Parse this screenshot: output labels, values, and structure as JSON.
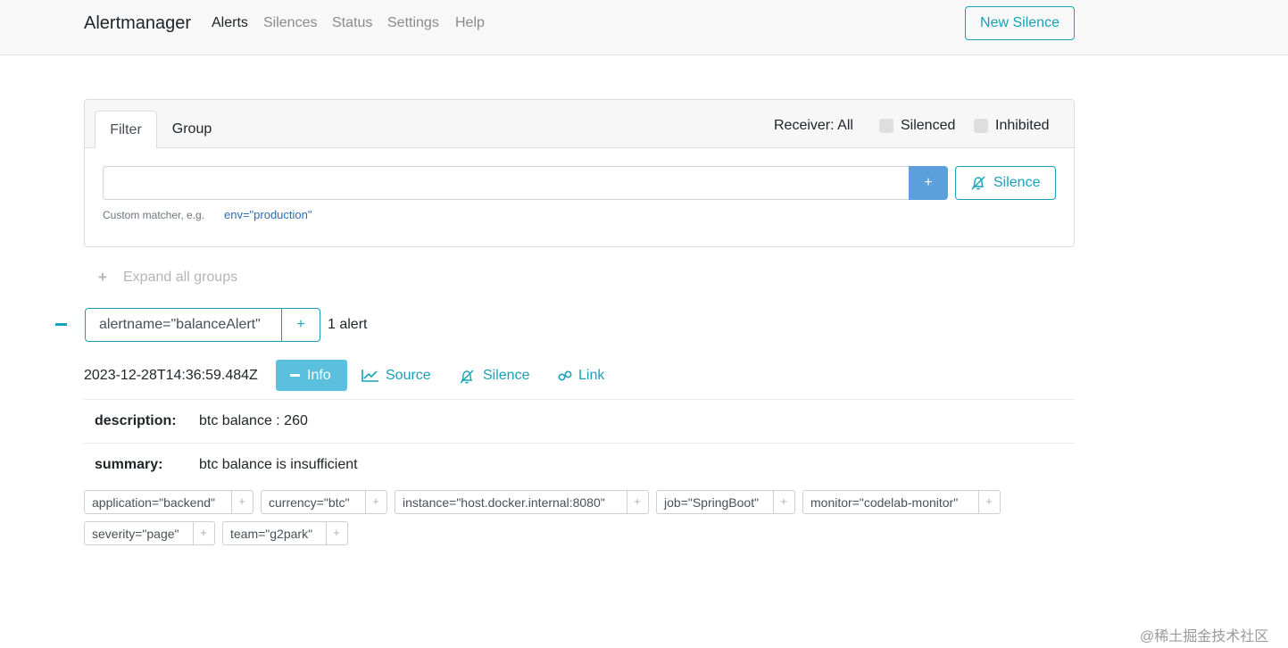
{
  "nav": {
    "brand": "Alertmanager",
    "links": [
      "Alerts",
      "Silences",
      "Status",
      "Settings",
      "Help"
    ],
    "new_silence": "New Silence"
  },
  "filter_card": {
    "tabs": [
      "Filter",
      "Group"
    ],
    "receiver": "Receiver: All",
    "silenced_label": "Silenced",
    "inhibited_label": "Inhibited",
    "input_value": "",
    "add_button": "+",
    "silence_button": "Silence",
    "hint": "Custom matcher, e.g.",
    "hint_example": "env=\"production\""
  },
  "expand_all": {
    "plus": "+",
    "label": "Expand all groups"
  },
  "group": {
    "matcher": "alertname=\"balanceAlert\"",
    "add": "+",
    "count": "1 alert"
  },
  "alert": {
    "time": "2023-12-28T14:36:59.484Z",
    "info": "Info",
    "source": "Source",
    "silence": "Silence",
    "link": "Link",
    "annotations": [
      {
        "key": "description:",
        "value": "btc balance : 260"
      },
      {
        "key": "summary:",
        "value": "btc balance is insufficient"
      }
    ],
    "labels": [
      "application=\"backend\"",
      "currency=\"btc\"",
      "instance=\"host.docker.internal:8080\"",
      "job=\"SpringBoot\"",
      "monitor=\"codelab-monitor\"",
      "severity=\"page\"",
      "team=\"g2park\""
    ],
    "label_plus": "+"
  },
  "watermark": "@稀土掘金技术社区",
  "colors": {
    "accent": "#17a2b8",
    "info": "#5bc0de",
    "primary": "#5b9fdc"
  }
}
